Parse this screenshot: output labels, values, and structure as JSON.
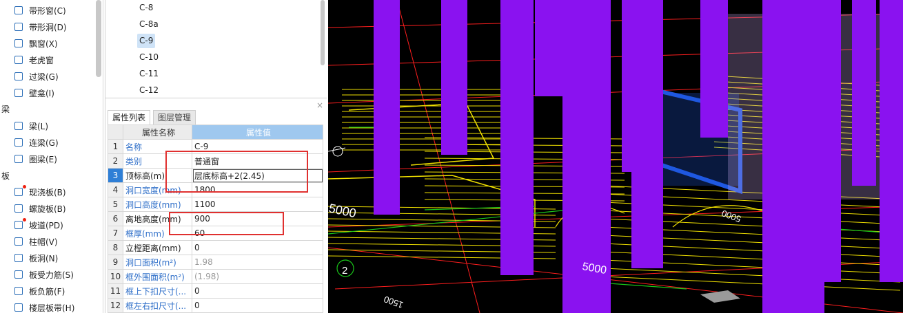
{
  "tree": {
    "items": [
      {
        "label": "带形窗(C)",
        "icon": "strip-window-icon"
      },
      {
        "label": "带形洞(D)",
        "icon": "strip-opening-icon"
      },
      {
        "label": "飘窗(X)",
        "icon": "bay-window-icon"
      },
      {
        "label": "老虎窗",
        "icon": "dormer-icon"
      },
      {
        "label": "过梁(G)",
        "icon": "lintel-icon"
      },
      {
        "label": "壁龛(I)",
        "icon": "niche-icon"
      }
    ],
    "cat_beam": "梁",
    "beams": [
      {
        "label": "梁(L)",
        "icon": "beam-icon"
      },
      {
        "label": "连梁(G)",
        "icon": "coupling-beam-icon"
      },
      {
        "label": "圈梁(E)",
        "icon": "ring-beam-icon"
      }
    ],
    "cat_slab": "板",
    "slabs": [
      {
        "label": "现浇板(B)",
        "icon": "cast-slab-icon",
        "dot": true
      },
      {
        "label": "螺旋板(B)",
        "icon": "spiral-slab-icon",
        "dot": false
      },
      {
        "label": "坡道(PD)",
        "icon": "ramp-icon",
        "dot": true
      },
      {
        "label": "柱帽(V)",
        "icon": "column-cap-icon",
        "dot": false
      },
      {
        "label": "板洞(N)",
        "icon": "slab-hole-icon",
        "dot": false
      },
      {
        "label": "板受力筋(S)",
        "icon": "slab-rebar-icon",
        "dot": false
      },
      {
        "label": "板负筋(F)",
        "icon": "negative-rebar-icon",
        "dot": false
      },
      {
        "label": "楼层板带(H)",
        "icon": "floor-strip-icon",
        "dot": false
      }
    ]
  },
  "components": [
    "C-8",
    "C-8a",
    "C-9",
    "C-10",
    "C-11",
    "C-12"
  ],
  "selected_component": "C-9",
  "tabs": [
    "属性列表",
    "图层管理"
  ],
  "table": {
    "header_name": "属性名称",
    "header_value": "属性值",
    "rows": [
      {
        "n": "1",
        "name": "名称",
        "value": "C-9",
        "blue": true,
        "gray": false
      },
      {
        "n": "2",
        "name": "类别",
        "value": "普通窗",
        "blue": true,
        "gray": false
      },
      {
        "n": "3",
        "name": "顶标高(m)",
        "value": "层底标高+2(2.45)",
        "blue": false,
        "gray": false
      },
      {
        "n": "4",
        "name": "洞口宽度(mm)",
        "value": "1800",
        "blue": true,
        "gray": false
      },
      {
        "n": "5",
        "name": "洞口高度(mm)",
        "value": "1100",
        "blue": true,
        "gray": false
      },
      {
        "n": "6",
        "name": "离地高度(mm)",
        "value": "900",
        "blue": false,
        "gray": false
      },
      {
        "n": "7",
        "name": "框厚(mm)",
        "value": "60",
        "blue": true,
        "gray": false
      },
      {
        "n": "8",
        "name": "立樘距离(mm)",
        "value": "0",
        "blue": false,
        "gray": false
      },
      {
        "n": "9",
        "name": "洞口面积(m²)",
        "value": "1.98",
        "blue": true,
        "gray": true
      },
      {
        "n": "10",
        "name": "框外围面积(m²)",
        "value": "(1.98)",
        "blue": true,
        "gray": true
      },
      {
        "n": "11",
        "name": "框上下扣尺寸(...",
        "value": "0",
        "blue": true,
        "gray": false
      },
      {
        "n": "12",
        "name": "框左右扣尺寸(...",
        "value": "0",
        "blue": true,
        "gray": false
      }
    ]
  },
  "viewport": {
    "labels": {
      "dim_a": "5000",
      "dim_b": "5000",
      "dim_c": "5000",
      "dim_d": "1500",
      "dim_e": "5000",
      "axis_2": "2"
    },
    "colors": {
      "column": "#8a12f0",
      "window": "#1f58e0",
      "grid": "#f0e000",
      "axis": "#ff1e1e",
      "guide": "#19c519",
      "bg": "#000000"
    }
  }
}
